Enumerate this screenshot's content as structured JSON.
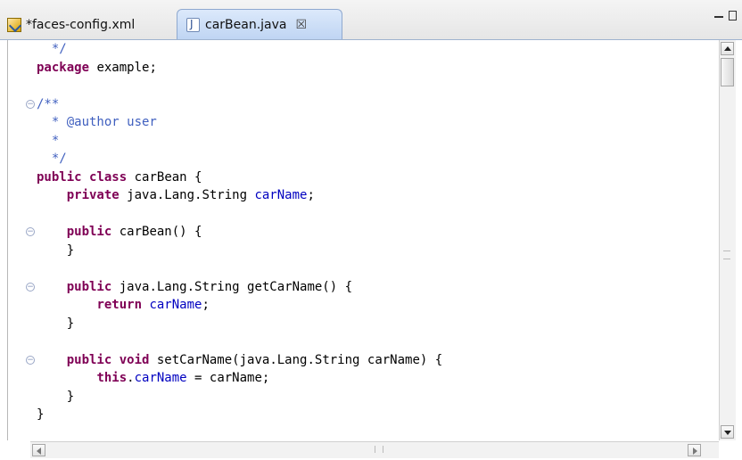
{
  "tabs": [
    {
      "label": "*faces-config.xml",
      "icon": "xml-file-icon",
      "active": false
    },
    {
      "label": "carBean.java",
      "icon": "java-file-icon",
      "active": true,
      "close_glyph": "☒"
    }
  ],
  "code_lines": [
    [
      {
        "t": "  */",
        "c": "cm"
      }
    ],
    [
      {
        "t": "package",
        "c": "kw"
      },
      {
        "t": " example;"
      }
    ],
    [
      {
        "t": ""
      }
    ],
    [
      {
        "t": "/**",
        "c": "cm"
      }
    ],
    [
      {
        "t": "  * @author user",
        "c": "cm"
      }
    ],
    [
      {
        "t": "  *",
        "c": "cm"
      }
    ],
    [
      {
        "t": "  */",
        "c": "cm"
      }
    ],
    [
      {
        "t": "public",
        "c": "kw"
      },
      {
        "t": " "
      },
      {
        "t": "class",
        "c": "kw"
      },
      {
        "t": " carBean {"
      }
    ],
    [
      {
        "t": "    "
      },
      {
        "t": "private",
        "c": "kw"
      },
      {
        "t": " java.Lang.String "
      },
      {
        "t": "carName",
        "c": "fd"
      },
      {
        "t": ";"
      }
    ],
    [
      {
        "t": ""
      }
    ],
    [
      {
        "t": "    "
      },
      {
        "t": "public",
        "c": "kw"
      },
      {
        "t": " carBean() {"
      }
    ],
    [
      {
        "t": "    }"
      }
    ],
    [
      {
        "t": ""
      }
    ],
    [
      {
        "t": "    "
      },
      {
        "t": "public",
        "c": "kw"
      },
      {
        "t": " java.Lang.String getCarName() {"
      }
    ],
    [
      {
        "t": "        "
      },
      {
        "t": "return",
        "c": "kw"
      },
      {
        "t": " "
      },
      {
        "t": "carName",
        "c": "fd"
      },
      {
        "t": ";"
      }
    ],
    [
      {
        "t": "    }"
      }
    ],
    [
      {
        "t": ""
      }
    ],
    [
      {
        "t": "    "
      },
      {
        "t": "public",
        "c": "kw"
      },
      {
        "t": " "
      },
      {
        "t": "void",
        "c": "kw"
      },
      {
        "t": " setCarName(java.Lang.String carName) {"
      }
    ],
    [
      {
        "t": "        "
      },
      {
        "t": "this",
        "c": "kw"
      },
      {
        "t": "."
      },
      {
        "t": "carName",
        "c": "fd"
      },
      {
        "t": " = carName;"
      }
    ],
    [
      {
        "t": "    }"
      }
    ],
    [
      {
        "t": "}"
      }
    ]
  ],
  "fold_markers": [
    3,
    10,
    13,
    17
  ],
  "colors": {
    "keyword": "#7f0055",
    "comment": "#3f5fbf",
    "field": "#0000c0",
    "active_tab": "#bfd5f3"
  }
}
